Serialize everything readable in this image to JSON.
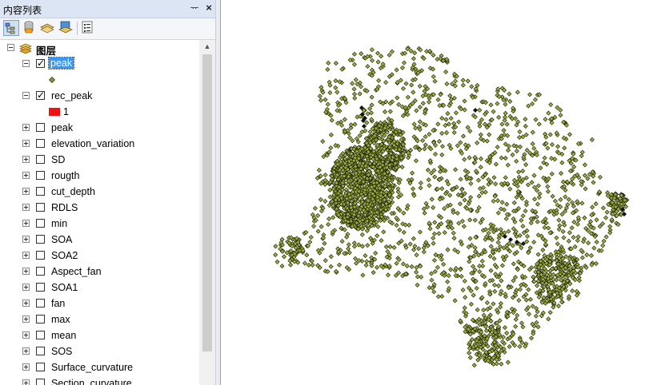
{
  "toc": {
    "title": "内容列表",
    "pin_glyph": "ᅲ",
    "close_glyph": "×",
    "toolbar": [
      {
        "name": "list-by-drawing-order-icon",
        "active": true
      },
      {
        "name": "list-by-source-icon",
        "active": false
      },
      {
        "name": "list-by-visibility-icon",
        "active": false
      },
      {
        "name": "list-by-selection-icon",
        "active": false
      },
      {
        "name": "options-icon",
        "active": false
      }
    ],
    "root": {
      "label": "图层",
      "icon": "layers-icon"
    },
    "layers": [
      {
        "label": "peak",
        "checked": true,
        "expanded": true,
        "selected": true,
        "legend": {
          "type": "point",
          "color": "#8a9a2e"
        }
      },
      {
        "label": "rec_peak",
        "checked": true,
        "expanded": true,
        "selected": false,
        "legend": {
          "type": "patch",
          "color": "#ee1111",
          "text": "1"
        }
      },
      {
        "label": "peak",
        "checked": false,
        "expanded": false
      },
      {
        "label": "elevation_variation",
        "checked": false,
        "expanded": false
      },
      {
        "label": "SD",
        "checked": false,
        "expanded": false
      },
      {
        "label": "rougth",
        "checked": false,
        "expanded": false
      },
      {
        "label": "cut_depth",
        "checked": false,
        "expanded": false
      },
      {
        "label": "RDLS",
        "checked": false,
        "expanded": false
      },
      {
        "label": "min",
        "checked": false,
        "expanded": false
      },
      {
        "label": "SOA",
        "checked": false,
        "expanded": false
      },
      {
        "label": "SOA2",
        "checked": false,
        "expanded": false
      },
      {
        "label": "Aspect_fan",
        "checked": false,
        "expanded": false
      },
      {
        "label": "SOA1",
        "checked": false,
        "expanded": false
      },
      {
        "label": "fan",
        "checked": false,
        "expanded": false
      },
      {
        "label": "max",
        "checked": false,
        "expanded": false
      },
      {
        "label": "mean",
        "checked": false,
        "expanded": false
      },
      {
        "label": "SOS",
        "checked": false,
        "expanded": false
      },
      {
        "label": "Surface_curvature",
        "checked": false,
        "expanded": false
      },
      {
        "label": "Section_curvature",
        "checked": false,
        "expanded": false
      }
    ]
  },
  "map": {
    "point_fill": "#9aae3c",
    "point_stroke": "#1a1a0a",
    "highlight_color": "#111111"
  }
}
